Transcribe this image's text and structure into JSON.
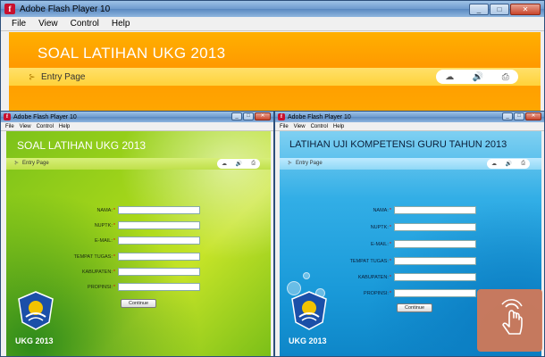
{
  "main_window": {
    "title": "Adobe Flash Player 10",
    "menu": [
      "File",
      "View",
      "Control",
      "Help"
    ],
    "heading": "SOAL LATIHAN UKG 2013",
    "bar_label": "Entry Page"
  },
  "window_green": {
    "title": "Adobe Flash Player 10",
    "menu": [
      "File",
      "View",
      "Control",
      "Help"
    ],
    "heading": "SOAL LATIHAN UKG 2013",
    "bar_label": "Entry Page",
    "fields": [
      {
        "label": "NAMA:",
        "req": "*"
      },
      {
        "label": "NUPTK:",
        "req": "*"
      },
      {
        "label": "E-MAIL:",
        "req": "*"
      },
      {
        "label": "TEMPAT TUGAS:",
        "req": "*"
      },
      {
        "label": "KABUPATEN:",
        "req": "*"
      },
      {
        "label": "PROPINSI:",
        "req": "*"
      }
    ],
    "continue_label": "Continue",
    "logo_text": "UKG 2013"
  },
  "window_blue": {
    "title": "Adobe Flash Player 10",
    "menu": [
      "File",
      "View",
      "Control",
      "Help"
    ],
    "heading": "LATIHAN UJI KOMPETENSI GURU TAHUN 2013",
    "bar_label": "Entry Page",
    "fields": [
      {
        "label": "NAMA:",
        "req": "*"
      },
      {
        "label": "NUPTK:",
        "req": "*"
      },
      {
        "label": "E-MAIL:",
        "req": "*"
      },
      {
        "label": "TEMPAT TUGAS:",
        "req": "*"
      },
      {
        "label": "KABUPATEN:",
        "req": "*"
      },
      {
        "label": "PROPINSI:",
        "req": "*"
      }
    ],
    "continue_label": "Continue",
    "logo_text": "UKG 2013"
  },
  "icons": [
    "cloud-icon",
    "speaker-icon",
    "printer-icon",
    "tap-gesture-icon"
  ],
  "colors": {
    "orange": "#ffa000",
    "green": "#a8d81a",
    "blue": "#1a9ad9",
    "overlay": "#d67856"
  }
}
